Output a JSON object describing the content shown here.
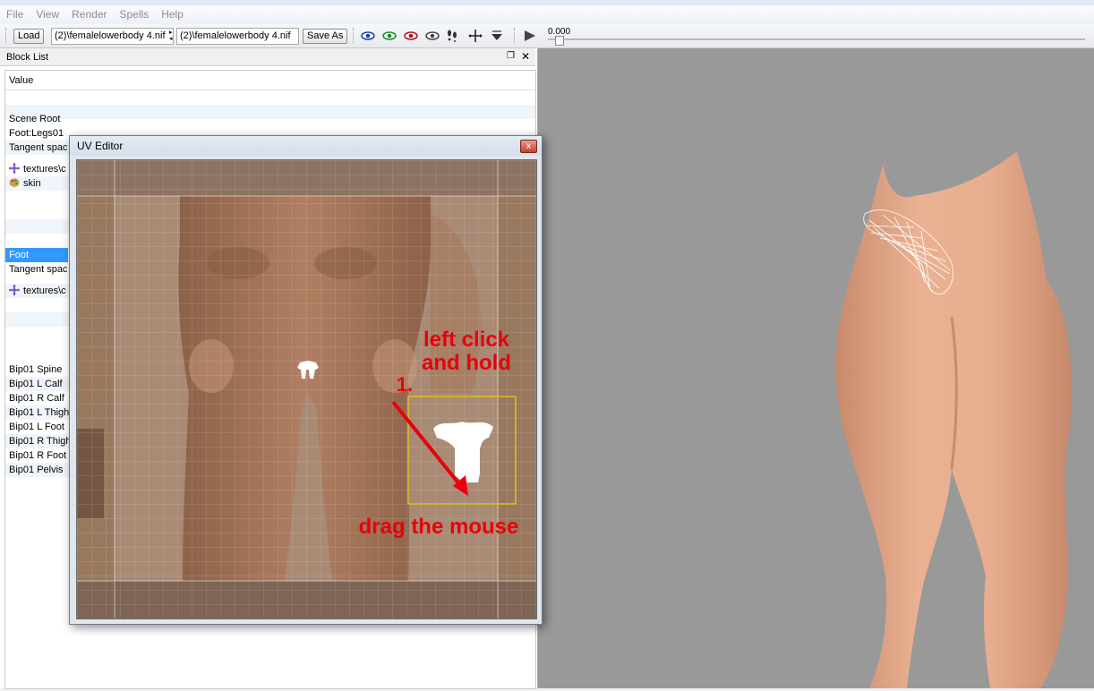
{
  "menu": [
    "File",
    "View",
    "Render",
    "Spells",
    "Help"
  ],
  "toolbar": {
    "load_label": "Load",
    "file_a": "(2)\\femalelowerbody 4.nif",
    "file_b": "(2)\\femalelowerbody 4.nif",
    "save_as_label": "Save As",
    "time_value": "0.000"
  },
  "block_list": {
    "title": "Block List",
    "column_header": "Value",
    "rows": [
      {
        "label": "Scene Root",
        "icon": ""
      },
      {
        "label": "Foot:Legs01",
        "icon": ""
      },
      {
        "label": "Tangent spac",
        "icon": ""
      },
      {
        "label": "textures\\c",
        "icon": "texture-icon"
      },
      {
        "label": "skin",
        "icon": "palette-icon"
      },
      {
        "label": "Foot",
        "icon": "",
        "selected": true
      },
      {
        "label": "Tangent spac",
        "icon": ""
      },
      {
        "label": "textures\\c",
        "icon": "texture-icon"
      },
      {
        "label": "Bip01 Spine",
        "icon": ""
      },
      {
        "label": "Bip01 L Calf",
        "icon": ""
      },
      {
        "label": "Bip01 R Calf",
        "icon": ""
      },
      {
        "label": "Bip01 L Thigh",
        "icon": ""
      },
      {
        "label": "Bip01 L Foot",
        "icon": ""
      },
      {
        "label": "Bip01 R Thigh",
        "icon": ""
      },
      {
        "label": "Bip01 R Foot",
        "icon": ""
      },
      {
        "label": "Bip01 Pelvis",
        "icon": ""
      }
    ]
  },
  "uv_editor": {
    "title": "UV Editor",
    "close_glyph": "x"
  },
  "annotations": {
    "step_number": "1.",
    "instruction_top": "left click\nand hold",
    "instruction_bottom": "drag the mouse"
  },
  "colors": {
    "selection": "#3399ff",
    "annotation": "#e8000b",
    "selection_box": "#e0c020",
    "viewport_bg": "#999999",
    "skin": "#e5a98b"
  }
}
